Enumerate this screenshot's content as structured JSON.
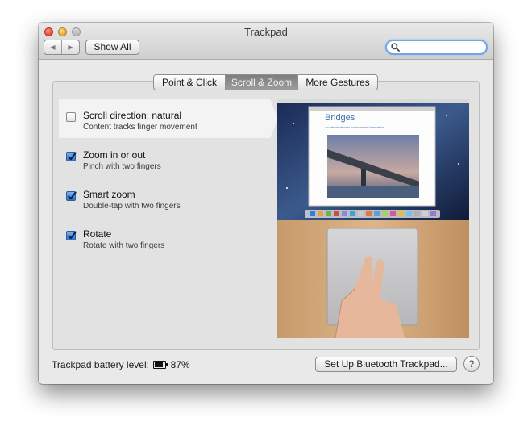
{
  "window": {
    "title": "Trackpad"
  },
  "toolbar": {
    "back_icon": "chevron-left-icon",
    "forward_icon": "chevron-right-icon",
    "show_all_label": "Show All",
    "search": {
      "value": "",
      "placeholder": "",
      "icon": "magnifier-icon"
    }
  },
  "tabs": [
    {
      "label": "Point & Click",
      "selected": false
    },
    {
      "label": "Scroll & Zoom",
      "selected": true
    },
    {
      "label": "More Gestures",
      "selected": false
    }
  ],
  "options": [
    {
      "title": "Scroll direction: natural",
      "subtitle": "Content tracks finger movement",
      "checked": false,
      "highlighted": true
    },
    {
      "title": "Zoom in or out",
      "subtitle": "Pinch with two fingers",
      "checked": true,
      "highlighted": false
    },
    {
      "title": "Smart zoom",
      "subtitle": "Double-tap with two fingers",
      "checked": true,
      "highlighted": false
    },
    {
      "title": "Rotate",
      "subtitle": "Rotate with two fingers",
      "checked": true,
      "highlighted": false
    }
  ],
  "preview": {
    "doc_title": "Bridges",
    "doc_subtitle": "An introduction to man's oldest innovation"
  },
  "footer": {
    "battery_label": "Trackpad battery level:",
    "battery_icon": "battery-icon",
    "battery_value": "87%",
    "setup_button_label": "Set Up Bluetooth Trackpad...",
    "help_label": "?"
  },
  "colors": {
    "accent": "#3b7fd9",
    "selected_tab": "#8a8a8a",
    "window_bg": "#e9e9e9"
  }
}
